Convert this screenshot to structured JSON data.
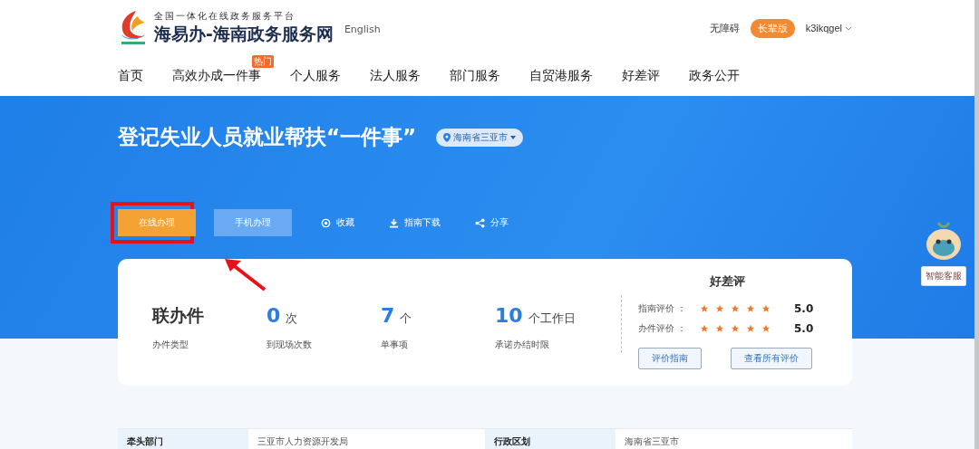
{
  "header": {
    "slogan": "全国一体化在线政务服务平台",
    "site_name": "海易办-海南政务服务网",
    "language_link": "English",
    "accessibility_link": "无障碍",
    "elder_mode": "长辈版",
    "user": "k3ikqgel"
  },
  "nav": [
    {
      "label": "首页"
    },
    {
      "label": "高效办成一件事",
      "badge": "热门"
    },
    {
      "label": "个人服务"
    },
    {
      "label": "法人服务"
    },
    {
      "label": "部门服务"
    },
    {
      "label": "自贸港服务"
    },
    {
      "label": "好差评"
    },
    {
      "label": "政务公开"
    }
  ],
  "hero": {
    "title": "登记失业人员就业帮扶“一件事”",
    "region": "海南省三亚市",
    "actions": [
      {
        "kind": "primary",
        "label": "在线办理",
        "highlighted": true
      },
      {
        "kind": "secondary",
        "label": "手机办理",
        "highlighted": false
      }
    ],
    "links": [
      {
        "kind": "favorite",
        "label": "收藏"
      },
      {
        "kind": "download",
        "label": "指南下载"
      },
      {
        "kind": "share",
        "label": "分享"
      }
    ]
  },
  "stats": [
    {
      "kind": "text",
      "value": "联办件",
      "label": "办件类型"
    },
    {
      "kind": "number",
      "value": "0",
      "unit": "次",
      "label": "到现场次数"
    },
    {
      "kind": "number",
      "value": "7",
      "unit": "个",
      "label": "单事项"
    },
    {
      "kind": "number",
      "value": "10",
      "unit": "个工作日",
      "label": "承诺办结时限"
    }
  ],
  "rating": {
    "title": "好差评",
    "rows": [
      {
        "label": "指南评价 ：",
        "stars": 5,
        "score": "5.0"
      },
      {
        "label": "办件评价 ：",
        "stars": 5,
        "score": "5.0"
      }
    ],
    "buttons": [
      "评价指南",
      "查看所有评价"
    ]
  },
  "assistant": {
    "label": "智能客服"
  },
  "info_table": [
    {
      "label": "牵头部门",
      "value": "三亚市人力资源开发局"
    },
    {
      "label": "行政区划",
      "value": "海南省三亚市"
    }
  ]
}
